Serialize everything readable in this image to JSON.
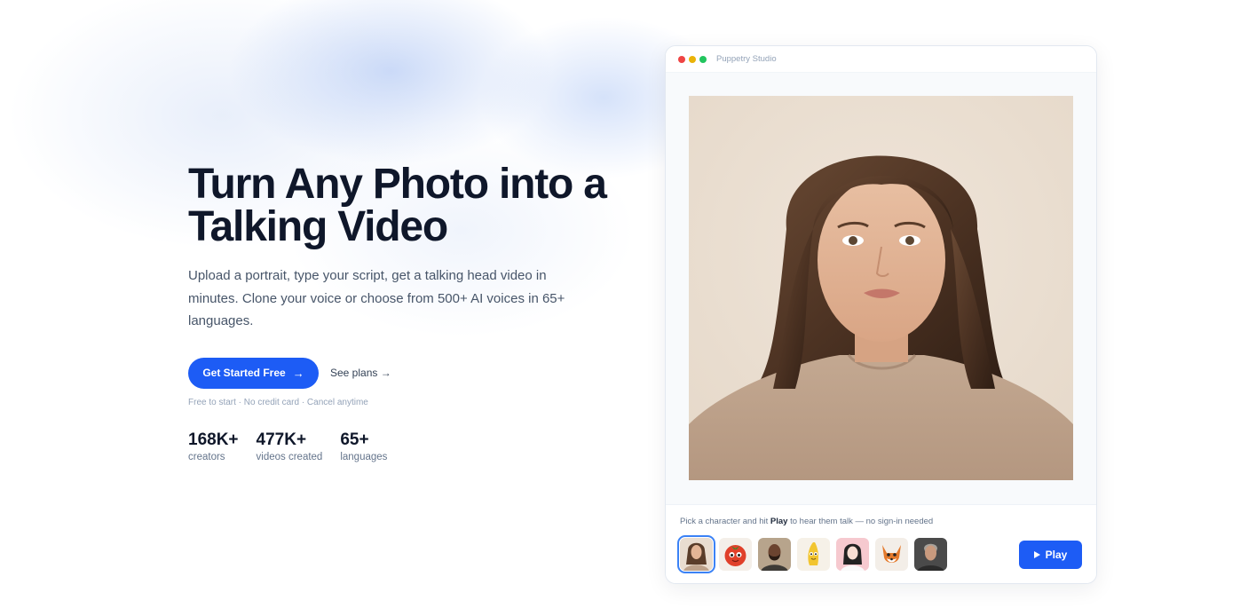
{
  "hero": {
    "title_line1": "Turn Any Photo into a",
    "title_line2": "Talking Video",
    "subtitle": "Upload a portrait, type your script, get a talking head video in minutes. Clone your voice or choose from 500+ AI voices in 65+ languages.",
    "cta_primary": "Get Started Free",
    "cta_secondary": "See plans →",
    "fine_print": "Free to start · No credit card · Cancel anytime"
  },
  "stats": [
    {
      "value": "168K+",
      "label": "creators"
    },
    {
      "value": "477K+",
      "label": "videos created"
    },
    {
      "value": "65+",
      "label": "languages"
    }
  ],
  "studio": {
    "window_title": "Puppetry Studio",
    "hint_pre": "Pick a character and hit ",
    "hint_bold": "Play",
    "hint_post": " to hear them talk — no sign-in needed",
    "play_label": "Play",
    "characters": [
      {
        "name": "woman-portrait",
        "selected": true
      },
      {
        "name": "tomato-mascot",
        "selected": false
      },
      {
        "name": "bearded-man",
        "selected": false
      },
      {
        "name": "banana-mascot",
        "selected": false
      },
      {
        "name": "anime-girl",
        "selected": false
      },
      {
        "name": "fox-mascot",
        "selected": false
      },
      {
        "name": "older-man",
        "selected": false
      }
    ]
  },
  "colors": {
    "accent": "#1d5cf5",
    "heading": "#0f172a",
    "body": "#475569",
    "muted": "#94a3b8"
  }
}
